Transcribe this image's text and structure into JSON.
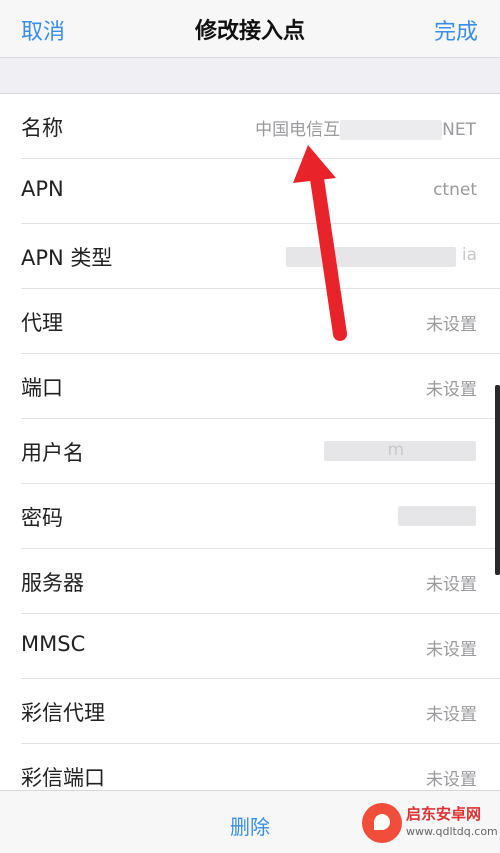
{
  "navbar": {
    "cancel_label": "取消",
    "title": "修改接入点",
    "done_label": "完成"
  },
  "rows": [
    {
      "label": "名称",
      "value": "中国电信互联网设置CTNET",
      "value_visible_prefix": "中国电信互",
      "value_visible_suffix": "NET"
    },
    {
      "label": "APN",
      "value": "ctnet"
    },
    {
      "label": "APN 类型",
      "value": "ia"
    },
    {
      "label": "代理",
      "value": "未设置"
    },
    {
      "label": "端口",
      "value": "未设置"
    },
    {
      "label": "用户名",
      "value": "m"
    },
    {
      "label": "密码",
      "value": ""
    },
    {
      "label": "服务器",
      "value": "未设置"
    },
    {
      "label": "MMSC",
      "value": "未设置"
    },
    {
      "label": "彩信代理",
      "value": "未设置"
    },
    {
      "label": "彩信端口",
      "value": "未设置"
    }
  ],
  "footer": {
    "delete_label": "删除"
  },
  "watermark": {
    "name": "启东安卓网",
    "url": "www.qdltdq.com"
  },
  "colors": {
    "accent": "#3a8ee6",
    "annotation_arrow": "#e8232a",
    "background": "#efeff4"
  }
}
